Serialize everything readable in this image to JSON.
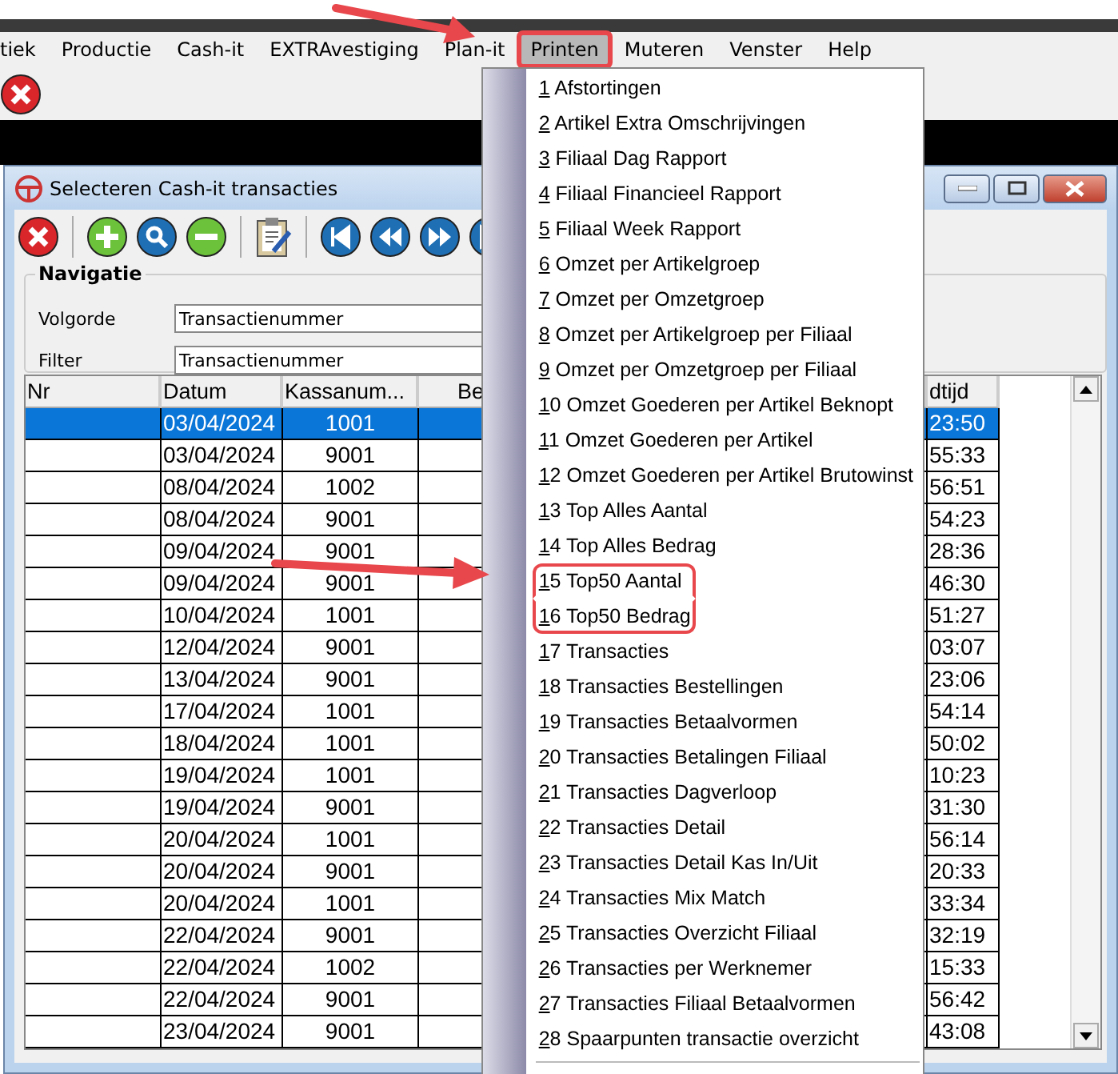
{
  "menubar": {
    "items": [
      {
        "label": "tiek",
        "selected": false
      },
      {
        "label": "Productie",
        "selected": false
      },
      {
        "label": "Cash-it",
        "selected": false
      },
      {
        "label": "EXTRAvestiging",
        "selected": false
      },
      {
        "label": "Plan-it",
        "selected": false
      },
      {
        "label": "Printen",
        "selected": true
      },
      {
        "label": "Muteren",
        "selected": false
      },
      {
        "label": "Venster",
        "selected": false
      },
      {
        "label": "Help",
        "selected": false
      }
    ]
  },
  "window": {
    "title": "Selecteren Cash-it transacties"
  },
  "navigation": {
    "title": "Navigatie",
    "fields": [
      {
        "label": "Volgorde",
        "value": "Transactienummer"
      },
      {
        "label": "Filter",
        "value": "Transactienummer"
      }
    ]
  },
  "table": {
    "columns": [
      "Nr",
      "Datum",
      "Kassanum...",
      "Be",
      "dtijd"
    ],
    "rows": [
      {
        "date": "03/04/2024",
        "register": "1001",
        "end_time": "23:50",
        "selected": true
      },
      {
        "date": "03/04/2024",
        "register": "9001",
        "end_time": "55:33",
        "selected": false
      },
      {
        "date": "08/04/2024",
        "register": "1002",
        "end_time": "56:51",
        "selected": false
      },
      {
        "date": "08/04/2024",
        "register": "9001",
        "end_time": "54:23",
        "selected": false
      },
      {
        "date": "09/04/2024",
        "register": "9001",
        "end_time": "28:36",
        "selected": false
      },
      {
        "date": "09/04/2024",
        "register": "9001",
        "end_time": "46:30",
        "selected": false
      },
      {
        "date": "10/04/2024",
        "register": "1001",
        "end_time": "51:27",
        "selected": false
      },
      {
        "date": "12/04/2024",
        "register": "9001",
        "end_time": "03:07",
        "selected": false
      },
      {
        "date": "13/04/2024",
        "register": "9001",
        "end_time": "23:06",
        "selected": false
      },
      {
        "date": "17/04/2024",
        "register": "1001",
        "end_time": "54:14",
        "selected": false
      },
      {
        "date": "18/04/2024",
        "register": "1001",
        "end_time": "50:02",
        "selected": false
      },
      {
        "date": "19/04/2024",
        "register": "1001",
        "end_time": "10:23",
        "selected": false
      },
      {
        "date": "19/04/2024",
        "register": "9001",
        "end_time": "31:30",
        "selected": false
      },
      {
        "date": "20/04/2024",
        "register": "1001",
        "end_time": "56:14",
        "selected": false
      },
      {
        "date": "20/04/2024",
        "register": "9001",
        "end_time": "20:33",
        "selected": false
      },
      {
        "date": "20/04/2024",
        "register": "1001",
        "end_time": "33:34",
        "selected": false
      },
      {
        "date": "22/04/2024",
        "register": "9001",
        "end_time": "32:19",
        "selected": false
      },
      {
        "date": "22/04/2024",
        "register": "1002",
        "end_time": "15:33",
        "selected": false
      },
      {
        "date": "22/04/2024",
        "register": "9001",
        "end_time": "56:42",
        "selected": false
      },
      {
        "date": "23/04/2024",
        "register": "9001",
        "end_time": "43:08",
        "selected": false
      }
    ]
  },
  "menu": {
    "items": [
      {
        "number": "1",
        "label": "Afstortingen",
        "highlighted": false
      },
      {
        "number": "2",
        "label": "Artikel Extra Omschrijvingen",
        "highlighted": false
      },
      {
        "number": "3",
        "label": "Filiaal Dag Rapport",
        "highlighted": false
      },
      {
        "number": "4",
        "label": "Filiaal Financieel Rapport",
        "highlighted": false
      },
      {
        "number": "5",
        "label": "Filiaal Week Rapport",
        "highlighted": false
      },
      {
        "number": "6",
        "label": "Omzet per Artikelgroep",
        "highlighted": false
      },
      {
        "number": "7",
        "label": "Omzet per Omzetgroep",
        "highlighted": false
      },
      {
        "number": "8",
        "label": "Omzet per Artikelgroep per Filiaal",
        "highlighted": false
      },
      {
        "number": "9",
        "label": "Omzet per Omzetgroep per Filiaal",
        "highlighted": false
      },
      {
        "number": "10",
        "label": "Omzet Goederen per Artikel Beknopt",
        "highlighted": false
      },
      {
        "number": "11",
        "label": "Omzet Goederen per Artikel",
        "highlighted": false
      },
      {
        "number": "12",
        "label": "Omzet Goederen per Artikel Brutowinst",
        "highlighted": false
      },
      {
        "number": "13",
        "label": "Top Alles Aantal",
        "highlighted": false
      },
      {
        "number": "14",
        "label": "Top Alles Bedrag",
        "highlighted": false
      },
      {
        "number": "15",
        "label": "Top50 Aantal",
        "highlighted": true
      },
      {
        "number": "16",
        "label": "Top50 Bedrag",
        "highlighted": true
      },
      {
        "number": "17",
        "label": "Transacties",
        "highlighted": false
      },
      {
        "number": "18",
        "label": "Transacties Bestellingen",
        "highlighted": false
      },
      {
        "number": "19",
        "label": "Transacties Betaalvormen",
        "highlighted": false
      },
      {
        "number": "20",
        "label": "Transacties Betalingen Filiaal",
        "highlighted": false
      },
      {
        "number": "21",
        "label": "Transacties Dagverloop",
        "highlighted": false
      },
      {
        "number": "22",
        "label": "Transacties Detail",
        "highlighted": false
      },
      {
        "number": "23",
        "label": "Transacties Detail Kas In/Uit",
        "highlighted": false
      },
      {
        "number": "24",
        "label": "Transacties Mix Match",
        "highlighted": false
      },
      {
        "number": "25",
        "label": "Transacties Overzicht Filiaal",
        "highlighted": false
      },
      {
        "number": "26",
        "label": "Transacties per Werknemer",
        "highlighted": false
      },
      {
        "number": "27",
        "label": "Transacties Filiaal Betaalvormen",
        "highlighted": false
      },
      {
        "number": "28",
        "label": "Spaarpunten transactie overzicht",
        "highlighted": false
      }
    ]
  }
}
